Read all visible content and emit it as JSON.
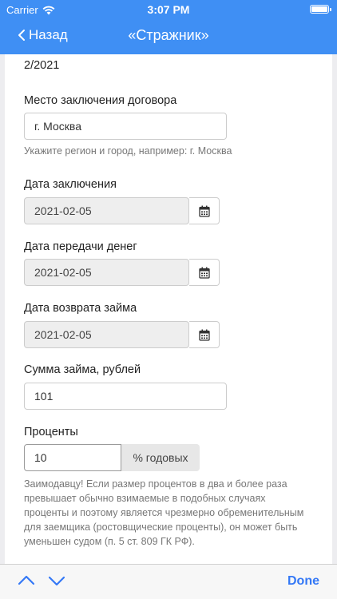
{
  "status_bar": {
    "carrier": "Carrier",
    "time": "3:07 PM"
  },
  "nav": {
    "back_label": "Назад",
    "title": "«Стражник»"
  },
  "form": {
    "top_text": "2/2021",
    "place": {
      "label": "Место заключения договора",
      "value": "г. Москва",
      "hint": "Укажите регион и город, например: г. Москва"
    },
    "conclusion_date": {
      "label": "Дата заключения",
      "value": "2021-02-05"
    },
    "transfer_date": {
      "label": "Дата передачи денег",
      "value": "2021-02-05"
    },
    "return_date": {
      "label": "Дата возврата займа",
      "value": "2021-02-05"
    },
    "amount": {
      "label": "Сумма займа, рублей",
      "value": "101"
    },
    "interest": {
      "label": "Проценты",
      "value": "10",
      "addon": "% годовых"
    },
    "warning": "Заимодавцу! Если размер процентов в два и более раза превышает обычно взимаемые в подобных случаях проценты и поэтому является чрезмерно обременительным для заемщика (ростовщические проценты), он может быть уменьшен судом (п. 5 ст. 809 ГК РФ)."
  },
  "toolbar": {
    "done_label": "Done"
  },
  "colors": {
    "nav_bar": "#3f8ff4",
    "done": "#3478f6"
  },
  "icons": [
    "wifi-icon",
    "battery-icon",
    "back-chevron-icon",
    "calendar-icon",
    "chevron-up-icon",
    "chevron-down-icon"
  ]
}
